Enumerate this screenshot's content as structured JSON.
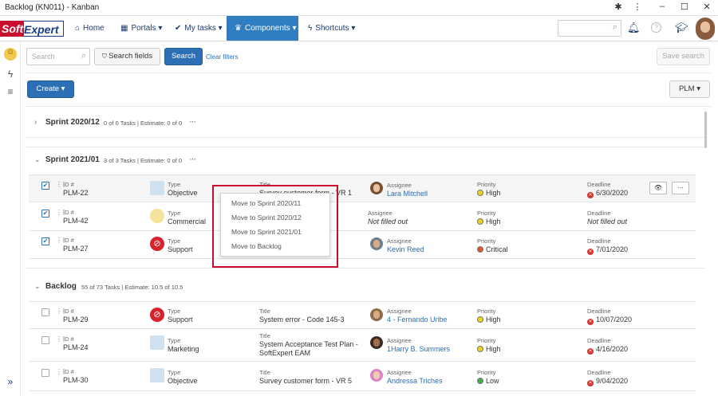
{
  "window": {
    "title": "Backlog (KN011) - Kanban",
    "controls": [
      "✱",
      "⋮",
      "–",
      "☐",
      "✕"
    ]
  },
  "nav": {
    "logo_part1": "Soft",
    "logo_part2": "Expert",
    "items": [
      {
        "label": "Home",
        "icon": "home-icon"
      },
      {
        "label": "Portals ▾",
        "icon": "grid-icon"
      },
      {
        "label": "My tasks ▾",
        "icon": "check-icon"
      },
      {
        "label": "Components ▾",
        "icon": "trophy-icon"
      },
      {
        "label": "Shortcuts ▾",
        "icon": "bolt-icon"
      }
    ],
    "active": "Components ▾",
    "right_icons": [
      "bell-icon",
      "help-icon",
      "graduation-cap-icon"
    ]
  },
  "toolbar": {
    "search_placeholder": "Search",
    "search_fields_label": "Search fields",
    "search_label": "Search",
    "clear_filters_label": "Clear filters",
    "save_search_label": "Save search",
    "create_label": "Create",
    "plm_label": "PLM"
  },
  "sprints": [
    {
      "name": "Sprint 2020/12",
      "meta": "0 of 0 Tasks | Estimate: 0 of 0",
      "collapsed": true
    },
    {
      "name": "Sprint 2021/01",
      "meta": "3 of 3 Tasks | Estimate: 0 of 0",
      "collapsed": false
    },
    {
      "name": "Backlog",
      "meta": "55 of 73 Tasks | Estimate: 10.5 of 10.5",
      "collapsed": false
    }
  ],
  "labels": {
    "id": "ID #",
    "type": "Type",
    "title": "Title",
    "assignee": "Assignee",
    "priority": "Priority",
    "deadline": "Deadline"
  },
  "tasks": [
    {
      "id": "PLM-22",
      "type": "Objective",
      "title": "Survey customer form - VR 1",
      "assignee": "Lara Mitchell",
      "priority": "High",
      "priority_color": "#f2d31b",
      "deadline": "6/30/2020",
      "checked": true
    },
    {
      "id": "PLM-42",
      "type": "Commercial",
      "title": "",
      "assignee": "Not filled out",
      "priority": "High",
      "priority_color": "#f2d31b",
      "deadline": "Not filled out",
      "checked": true
    },
    {
      "id": "PLM-27",
      "type": "Support",
      "title": "",
      "assignee": "Kevin Reed",
      "priority": "Critical",
      "priority_color": "#e0562b",
      "deadline": "7/01/2020",
      "checked": true
    },
    {
      "id": "PLM-29",
      "type": "Support",
      "title": "System error - Code 145-3",
      "assignee": "4 - Fernando Uribe",
      "priority": "High",
      "priority_color": "#f2d31b",
      "deadline": "10/07/2020",
      "checked": false
    },
    {
      "id": "PLM-24",
      "type": "Marketing",
      "title": "System Acceptance Test Plan -",
      "title2": "SoftExpert EAM",
      "assignee": "1Harry B. Summers",
      "priority": "High",
      "priority_color": "#f2d31b",
      "deadline": "4/16/2020",
      "checked": false
    },
    {
      "id": "PLM-30",
      "type": "Objective",
      "title": "Survey customer form - VR 5",
      "assignee": "Andressa Triches",
      "priority": "Low",
      "priority_color": "#3cb043",
      "deadline": "9/04/2020",
      "checked": false
    }
  ],
  "row_buttons": {
    "view": "👁",
    "more": "···"
  },
  "context_menu": [
    "Move to Sprint 2020/11",
    "Move to Sprint 2020/12",
    "Move to Sprint 2021/01",
    "Move to Backlog"
  ],
  "colors": {
    "accent": "#2f7ec2",
    "primary": "#2d6fb5",
    "highlight": "#c8102e"
  }
}
